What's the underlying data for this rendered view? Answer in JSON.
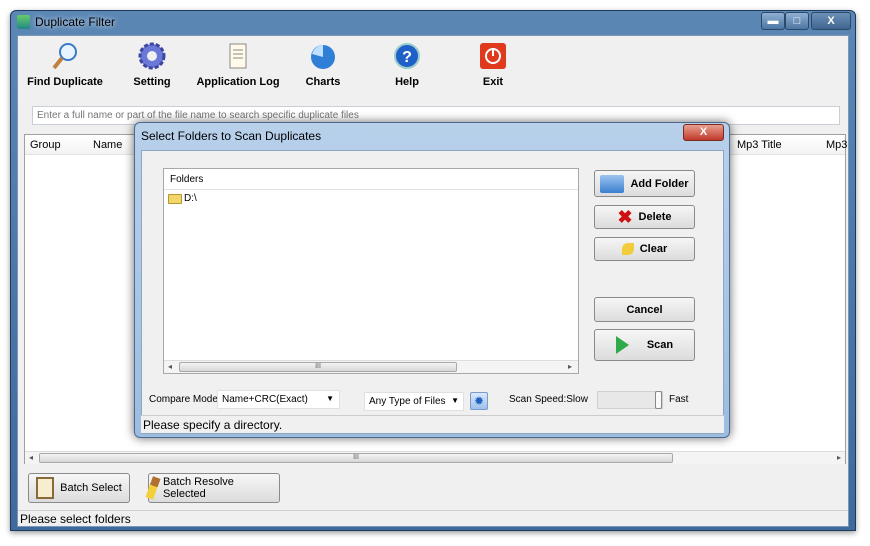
{
  "window": {
    "title": "Duplicate Filter",
    "minimize": "▬",
    "maximize": "□",
    "close": "X"
  },
  "toolbar": [
    {
      "label": "Find Duplicate",
      "icon": "magnifier-icon"
    },
    {
      "label": "Setting",
      "icon": "gear-icon"
    },
    {
      "label": "Application Log",
      "icon": "notepad-icon"
    },
    {
      "label": "Charts",
      "icon": "pie-chart-icon"
    },
    {
      "label": "Help",
      "icon": "help-icon"
    },
    {
      "label": "Exit",
      "icon": "power-icon"
    }
  ],
  "search": {
    "placeholder": "Enter a full name or part of the file name to search specific duplicate files"
  },
  "list": {
    "columns": [
      "Group",
      "Name",
      "Mp3 Title",
      "Mp3"
    ],
    "scroll_grip": "III"
  },
  "bottom": {
    "batch_select": "Batch Select",
    "batch_resolve": "Batch Resolve Selected"
  },
  "status": "Please select folders",
  "dialog": {
    "title": "Select Folders to Scan Duplicates",
    "close": "X",
    "folders_header": "Folders",
    "folders": [
      "D:\\"
    ],
    "buttons": {
      "add": "Add Folder",
      "delete": "Delete",
      "clear": "Clear",
      "cancel": "Cancel",
      "scan": "Scan"
    },
    "compare_label": "Compare Mode:",
    "compare_value": "Name+CRC(Exact)",
    "file_type": "Any Type of Files",
    "speed_label": "Scan Speed:Slow",
    "speed_fast": "Fast",
    "speed_level": 1.0,
    "status": "Please specify a directory.",
    "scroll_grip": "III"
  }
}
